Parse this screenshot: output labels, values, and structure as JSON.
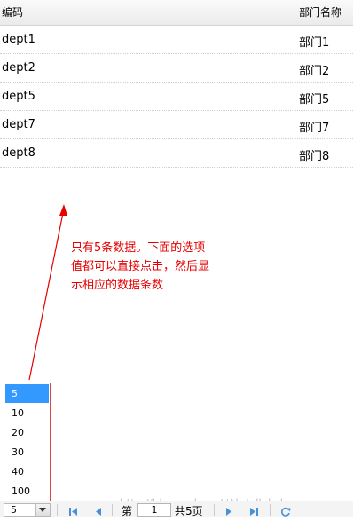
{
  "grid": {
    "columns": [
      "编码",
      "部门名称"
    ],
    "rows": [
      [
        "dept1",
        "部门1"
      ],
      [
        "dept2",
        "部门2"
      ],
      [
        "dept5",
        "部门5"
      ],
      [
        "dept7",
        "部门7"
      ],
      [
        "dept8",
        "部门8"
      ]
    ]
  },
  "annotation": {
    "line1": "只有5条数据。下面的选项",
    "line2": "值都可以直接点击，然后显",
    "line3": "示相应的数据条数",
    "color": "#e60000"
  },
  "page_size": {
    "current": "5",
    "options": [
      "5",
      "10",
      "20",
      "30",
      "40",
      "100"
    ]
  },
  "pager": {
    "page_prefix": "第",
    "page_value": "1",
    "page_suffix": "共5页",
    "first_icon": "first-page-icon",
    "prev_icon": "prev-page-icon",
    "next_icon": "next-page-icon",
    "last_icon": "last-page-icon",
    "refresh_icon": "refresh-icon"
  },
  "watermark": "http://blog.csdn.net/Abdullah_kanye"
}
